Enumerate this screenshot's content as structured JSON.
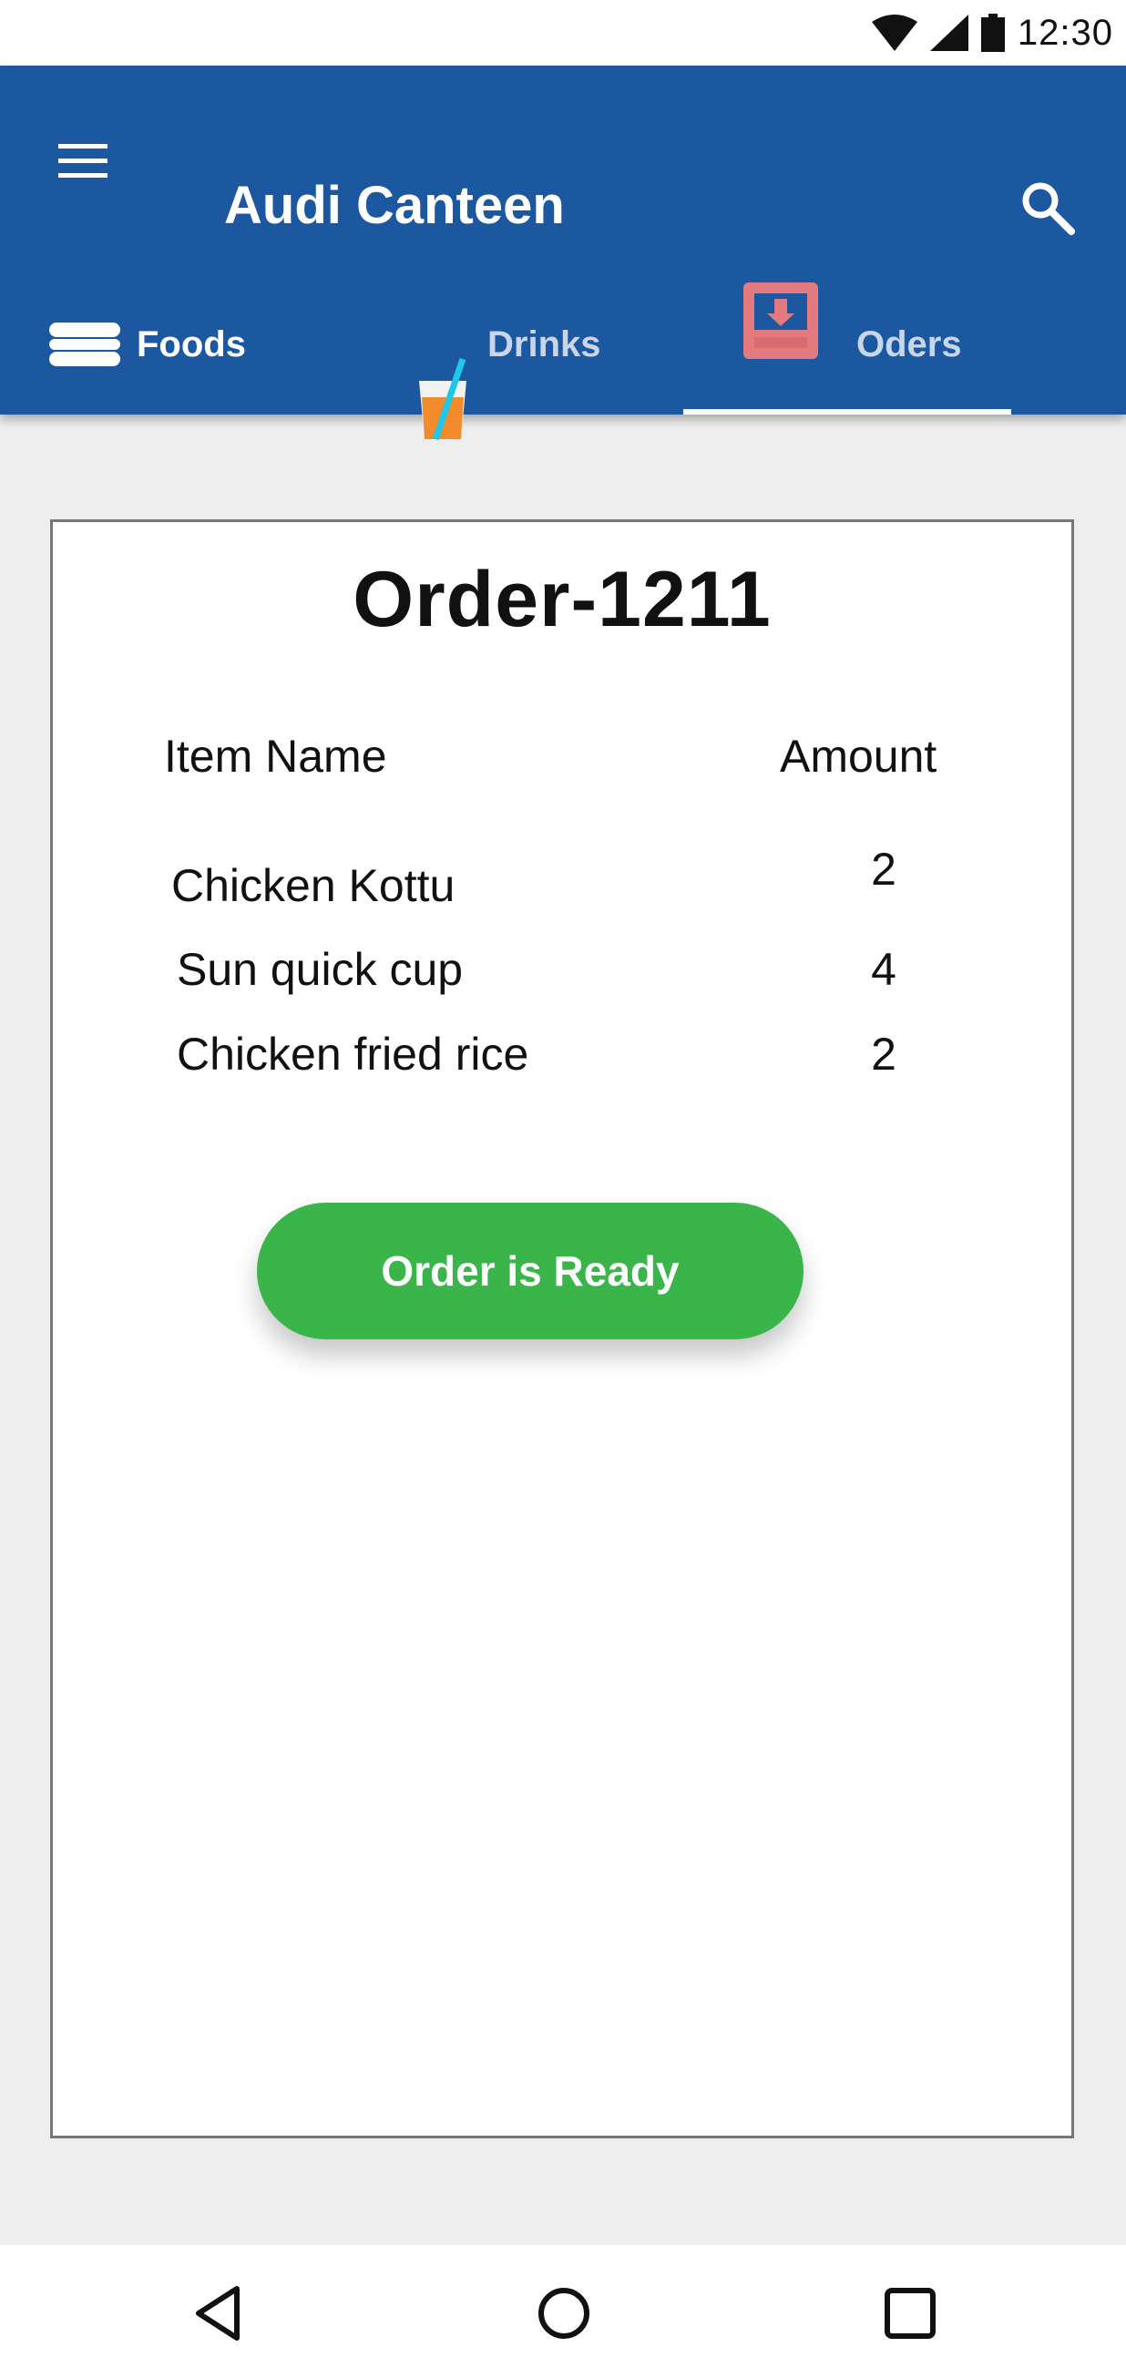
{
  "status_bar": {
    "time": "12:30",
    "icons": [
      "wifi-icon",
      "cell-signal-icon",
      "battery-icon"
    ]
  },
  "app_bar": {
    "title": "Audi Canteen",
    "icons": [
      "menu-icon",
      "search-icon"
    ]
  },
  "tabs": [
    {
      "label": "Foods",
      "icon": "burger-icon",
      "selected": false
    },
    {
      "label": "Drinks",
      "icon": "drink-cup-icon",
      "selected": false
    },
    {
      "label": "Oders",
      "icon": "inbox-download-icon",
      "selected": true
    }
  ],
  "order": {
    "title": "Order-1211",
    "headers": {
      "item": "Item Name",
      "amount": "Amount"
    },
    "items": [
      {
        "name": "Chicken Kottu",
        "amount": "2"
      },
      {
        "name": "Sun quick cup",
        "amount": "4"
      },
      {
        "name": "Chicken fried rice",
        "amount": "2"
      }
    ],
    "button_label": "Order is Ready"
  },
  "navbar": {
    "icons": [
      "back-icon",
      "home-icon",
      "recents-icon"
    ]
  },
  "colors": {
    "app_bar": "#1c58a0",
    "accent_button": "#39b54a",
    "background": "#eeeeee",
    "orders_icon": "#e27a7f"
  }
}
